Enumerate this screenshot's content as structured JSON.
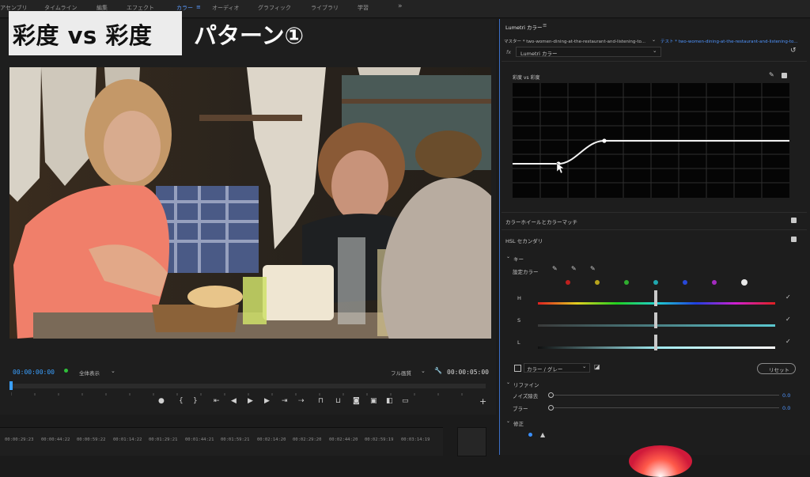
{
  "workspaces": [
    "アセンブリ",
    "タイムライン",
    "編集",
    "エフェクト",
    "カラー",
    "オーディオ",
    "グラフィック",
    "ライブラリ",
    "学習"
  ],
  "workspace_more": "»",
  "overlay": {
    "title_main": "彩度 vs 彩度",
    "title_sub": "パターン①"
  },
  "monitor": {
    "timecode_current": "00:00:00:00",
    "fit_label": "全体表示",
    "quality_label": "フル画質",
    "timecode_duration": "00:00:05:00"
  },
  "timeline_ruler": [
    "00:00:29:23",
    "00:00:44:22",
    "00:00:59:22",
    "00:01:14:22",
    "00:01:29:21",
    "00:01:44:21",
    "00:01:59:21",
    "00:02:14:20",
    "00:02:29:20",
    "00:02:44:20",
    "00:02:59:19",
    "00:03:14:19"
  ],
  "lumetri": {
    "panel_title": "Lumetri カラー",
    "master_label": "マスター * two-women-dining-at-the-restaurant-and-listening-to...",
    "target_label": "テスト * two-women-dining-at-the-restaurant-and-listening-to...",
    "fx_label": "fx",
    "effect_name": "Lumetri カラー",
    "curve_label": "彩度 vs 彩度",
    "colorwheel_section": "カラーホイールとカラーマッチ",
    "hsl_section": "HSL セカンダリ",
    "key_label": "キー",
    "set_color_label": "設定カラー",
    "swatch_colors": [
      "#c0201e",
      "#b8a41c",
      "#2fae2f",
      "#20a8b0",
      "#2848d8",
      "#a42bc0",
      "#e8e8e8"
    ],
    "hsl_rows": [
      "H",
      "S",
      "L"
    ],
    "view_label": "カラー / グレー",
    "reset_label": "リセット",
    "refine_label": "リファイン",
    "denoise_label": "ノイズ除去",
    "denoise_value": "0.0",
    "blur_label": "ブラー",
    "blur_value": "0.0",
    "correction_label": "修正"
  }
}
